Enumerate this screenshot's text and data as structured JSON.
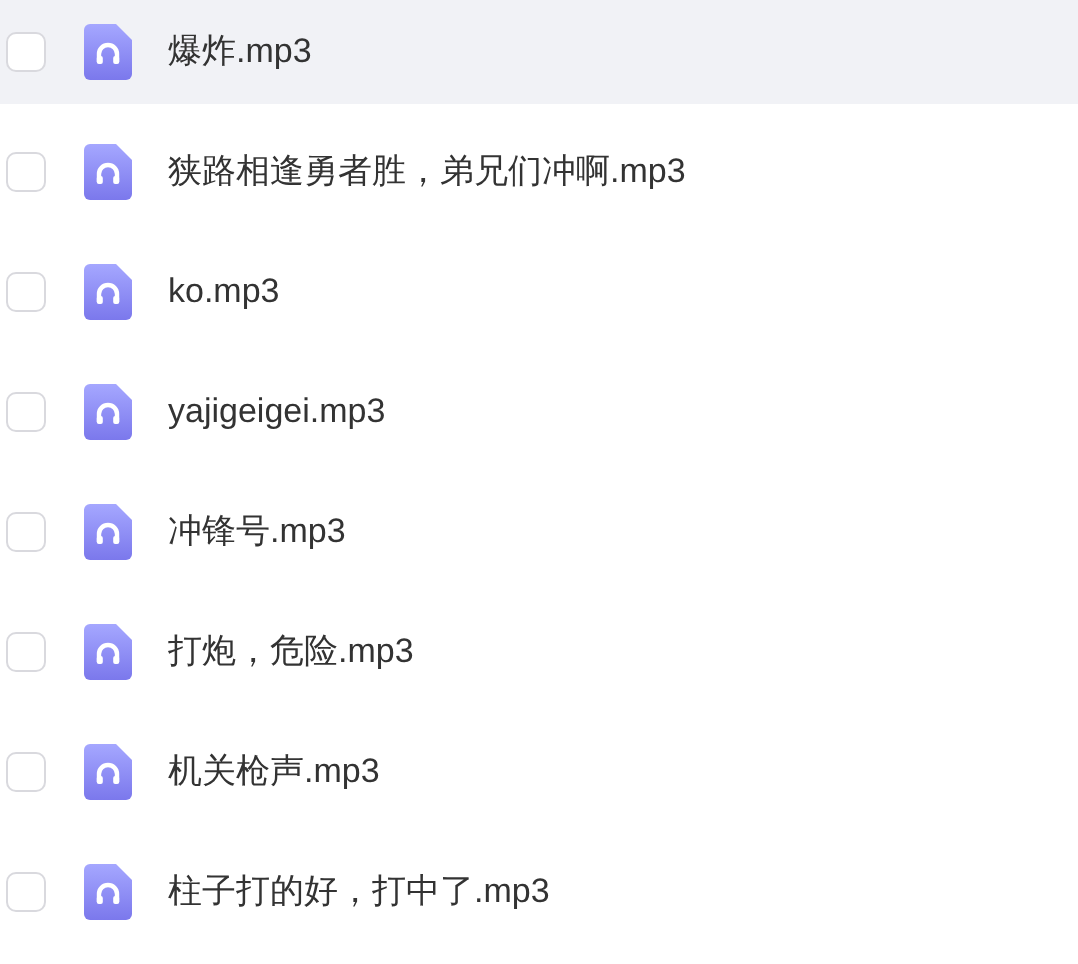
{
  "files": [
    {
      "name": "爆炸.mp3",
      "checked": false,
      "highlighted": true
    },
    {
      "name": "狭路相逢勇者胜，弟兄们冲啊.mp3",
      "checked": false,
      "highlighted": false
    },
    {
      "name": "ko.mp3",
      "checked": false,
      "highlighted": false
    },
    {
      "name": "yajigeigei.mp3",
      "checked": false,
      "highlighted": false
    },
    {
      "name": "冲锋号.mp3",
      "checked": false,
      "highlighted": false
    },
    {
      "name": "打炮，危险.mp3",
      "checked": false,
      "highlighted": false
    },
    {
      "name": "机关枪声.mp3",
      "checked": false,
      "highlighted": false
    },
    {
      "name": "柱子打的好，打中了.mp3",
      "checked": false,
      "highlighted": false
    }
  ]
}
